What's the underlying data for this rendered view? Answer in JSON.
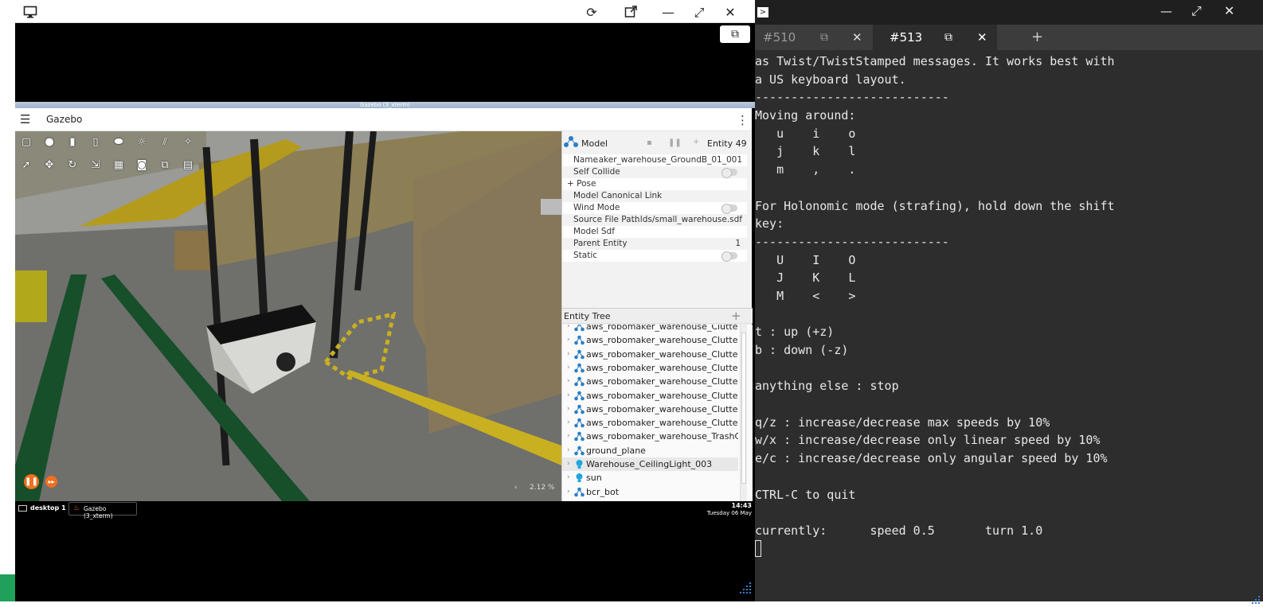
{
  "left_window": {
    "topbar": {
      "monitor_icon": "monitor-icon",
      "icons": [
        "refresh-icon",
        "open-external-icon",
        "minimize-icon",
        "maximize-icon",
        "close-icon"
      ]
    }
  },
  "xterm_title": "Gazebo (3_xterm)",
  "gazebo": {
    "title": "Gazebo",
    "model_panel": {
      "header": "Model",
      "entity": "Entity 49",
      "rows": [
        {
          "key": "Name",
          "value": "...aker_warehouse_GroundB_01_001"
        },
        {
          "key": "Self Collide"
        },
        {
          "key": "+ Pose"
        },
        {
          "key": "Model Canonical Link"
        },
        {
          "key": "Wind Mode"
        },
        {
          "key": "Source File Path",
          "value": "...lds/small_warehouse.sdf"
        },
        {
          "key": "Model Sdf"
        },
        {
          "key": "Parent Entity",
          "value": "1"
        },
        {
          "key": "Static"
        }
      ]
    },
    "entity_tree": {
      "header": "Entity Tree",
      "add": "+",
      "items": [
        "aws_robomaker_warehouse_Cluttering",
        "aws_robomaker_warehouse_Cluttering",
        "aws_robomaker_warehouse_Cluttering",
        "aws_robomaker_warehouse_Cluttering",
        "aws_robomaker_warehouse_Cluttering",
        "aws_robomaker_warehouse_Cluttering",
        "aws_robomaker_warehouse_Cluttering",
        "aws_robomaker_warehouse_Cluttering",
        "aws_robomaker_warehouse_TrashCanC",
        "ground_plane",
        "Warehouse_CeilingLight_003",
        "sun",
        "bcr_bot"
      ]
    },
    "rtf": "2.12 %",
    "rtf_arrow": "‹"
  },
  "taskbar": {
    "desktop": "desktop 1",
    "app": "Gazebo (3_xterm)",
    "time": "14:43",
    "date": "Tuesday 06 May"
  },
  "terminal": {
    "tabs": [
      {
        "label": "#510"
      },
      {
        "label": "#513"
      }
    ],
    "new_tab": "+",
    "lines": [
      "as Twist/TwistStamped messages. It works best with",
      "a US keyboard layout.",
      "---------------------------",
      "Moving around:",
      "   u    i    o",
      "   j    k    l",
      "   m    ,    .",
      "",
      "For Holonomic mode (strafing), hold down the shift",
      "key:",
      "---------------------------",
      "   U    I    O",
      "   J    K    L",
      "   M    <    >",
      "",
      "t : up (+z)",
      "b : down (-z)",
      "",
      "anything else : stop",
      "",
      "q/z : increase/decrease max speeds by 10%",
      "w/x : increase/decrease only linear speed by 10%",
      "e/c : increase/decrease only angular speed by 10%",
      "",
      "CTRL-C to quit",
      "",
      "currently:      speed 0.5       turn 1.0"
    ]
  },
  "colors": {
    "terminal_bg": "#2d2d2d",
    "model_icon": "#2a7fc4",
    "play_button": "#f07020"
  }
}
